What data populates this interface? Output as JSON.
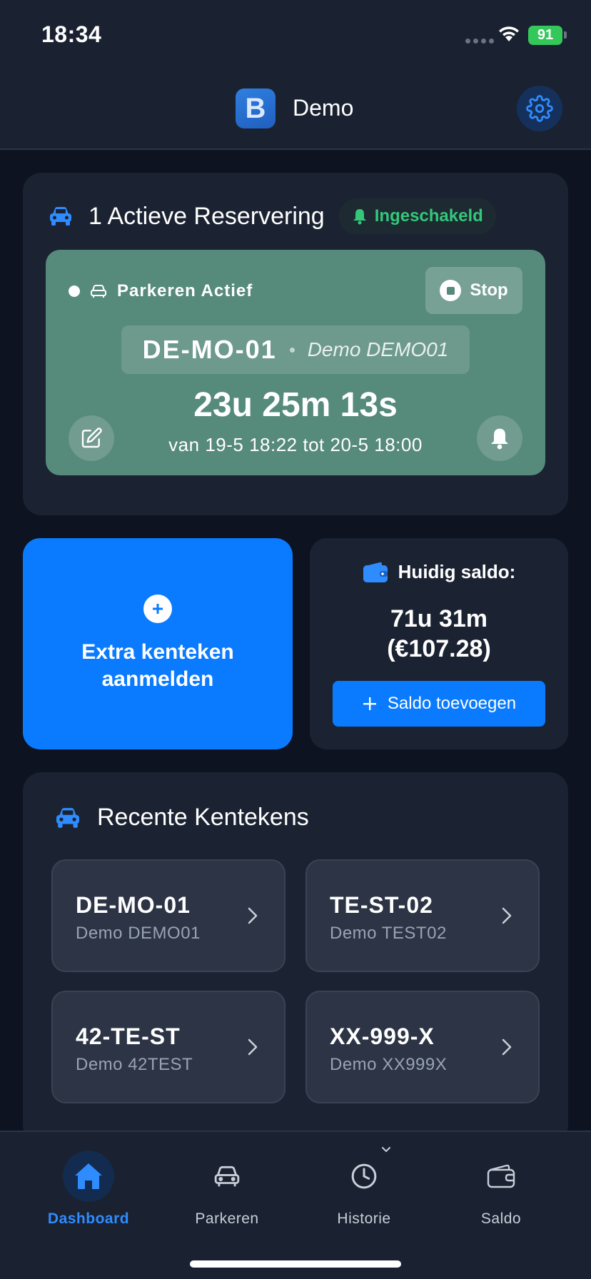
{
  "status_bar": {
    "time": "18:34",
    "battery": "91"
  },
  "header": {
    "logo_letter": "B",
    "title": "Demo"
  },
  "reservation": {
    "title": "1 Actieve Reservering",
    "badge": "Ingeschakeld",
    "status": "Parkeren Actief",
    "stop_label": "Stop",
    "plate": "DE-MO-01",
    "plate_desc": "Demo DEMO01",
    "timer": "23u 25m 13s",
    "period": "van 19-5 18:22 tot 20-5 18:00"
  },
  "extra": {
    "label": "Extra kenteken aanmelden"
  },
  "balance": {
    "label": "Huidig saldo:",
    "value_time": "71u 31m",
    "value_money": "(€107.28)",
    "add_label": "Saldo toevoegen"
  },
  "recent": {
    "title": "Recente Kentekens",
    "items": [
      {
        "plate": "DE-MO-01",
        "desc": "Demo DEMO01"
      },
      {
        "plate": "TE-ST-02",
        "desc": "Demo TEST02"
      },
      {
        "plate": "42-TE-ST",
        "desc": "Demo 42TEST"
      },
      {
        "plate": "XX-999-X",
        "desc": "Demo XX999X"
      }
    ]
  },
  "tabs": [
    {
      "label": "Dashboard",
      "icon": "home-icon",
      "active": true
    },
    {
      "label": "Parkeren",
      "icon": "car-icon",
      "active": false
    },
    {
      "label": "Historie",
      "icon": "clock-icon",
      "active": false
    },
    {
      "label": "Saldo",
      "icon": "wallet-icon",
      "active": false
    }
  ],
  "colors": {
    "accent": "#0a7bff",
    "success": "#34c77a",
    "parking_box": "#568a7a",
    "card": "#1b2332",
    "background": "#0d1320"
  }
}
